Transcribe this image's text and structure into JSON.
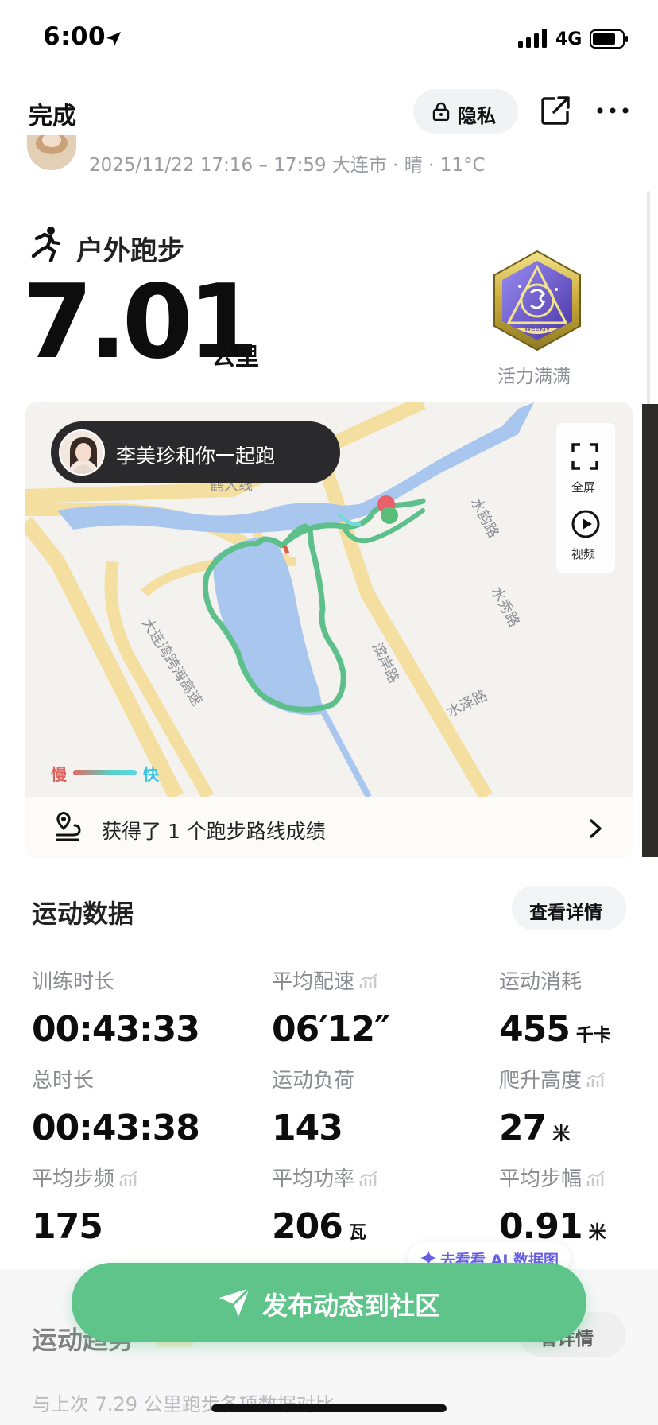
{
  "status_bar": {
    "time": "6:00",
    "network": "4G",
    "location_icon": "location-arrow-icon",
    "signal_icon": "signal-bars-icon",
    "battery_icon": "battery-icon"
  },
  "top_bar": {
    "done_label": "完成",
    "privacy_label": "隐私",
    "privacy_icon": "lock-icon",
    "share_icon": "share-icon",
    "more_icon": "more-icon"
  },
  "meta": {
    "line": "2025/11/22 17:16 – 17:59 大连市 · 晴 · 11°C"
  },
  "activity": {
    "type": "户外跑步",
    "distance": "7.01",
    "unit": "公里",
    "badge_label": "活力满满",
    "badge_text": "Weekly"
  },
  "map": {
    "together_text": "李美珍和你一起跑",
    "fullscreen_label": "全屏",
    "video_label": "视频",
    "speed_slow": "慢",
    "speed_fast": "快",
    "roads": {
      "r1": "鹤大线",
      "r2": "水韵路",
      "r3": "水秀路",
      "r4": "滨岸路",
      "r5": "水泽路",
      "r6": "大连湾跨海高速"
    },
    "achievement_text": "获得了 1 个跑步路线成绩"
  },
  "stats": {
    "title": "运动数据",
    "detail_label": "查看详情",
    "items": [
      {
        "label": "训练时长",
        "value": "00:43:33",
        "unit": "",
        "trend": false
      },
      {
        "label": "平均配速",
        "value": "06′12″",
        "unit": "",
        "trend": true
      },
      {
        "label": "运动消耗",
        "value": "455",
        "unit": "千卡",
        "trend": false
      },
      {
        "label": "总时长",
        "value": "00:43:38",
        "unit": "",
        "trend": false
      },
      {
        "label": "运动负荷",
        "value": "143",
        "unit": "",
        "trend": false
      },
      {
        "label": "爬升高度",
        "value": "27",
        "unit": "米",
        "trend": true
      },
      {
        "label": "平均步频",
        "value": "175",
        "unit": "",
        "trend": true
      },
      {
        "label": "平均功率",
        "value": "206",
        "unit": "瓦",
        "trend": true
      },
      {
        "label": "平均步幅",
        "value": "0.91",
        "unit": "米",
        "trend": true
      }
    ]
  },
  "ai": {
    "label": "去看看 AI 数据图"
  },
  "post": {
    "label": "发布动态到社区"
  },
  "trend_section": {
    "title": "运动趋势",
    "detail_label": "看详情",
    "compare_text": "与上次 7.29 公里跑步各项数据对比"
  },
  "colors": {
    "accent_green": "#5ec48a",
    "route_green": "#5dbf8a",
    "water_blue": "#a9c6ee",
    "road_yellow": "#f5dfa0",
    "ai_purple": "#6a5be6"
  }
}
